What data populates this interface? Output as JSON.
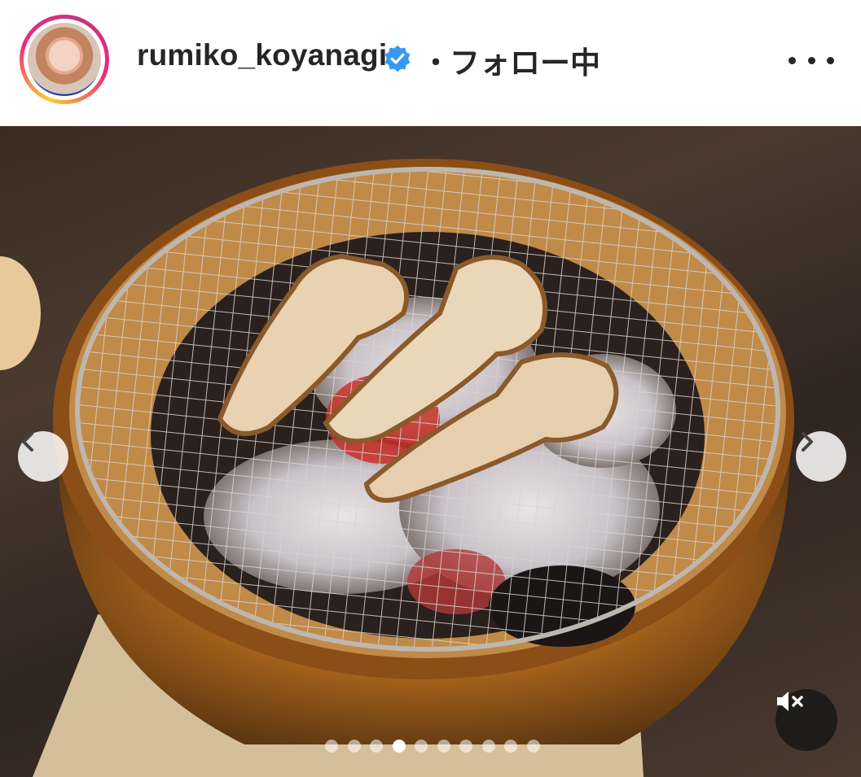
{
  "post": {
    "username": "rumiko_koyanagi",
    "verified": true,
    "separator": "・",
    "follow_status": "フォロー中"
  },
  "icons": {
    "avatar": "profile-avatar",
    "verified": "verified-badge-icon",
    "more": "more-options-icon",
    "prev": "chevron-left-icon",
    "next": "chevron-right-icon",
    "mute": "speaker-muted-icon"
  },
  "carousel": {
    "total_slides": 10,
    "active_slide": 4
  },
  "colors": {
    "verified_blue": "#3897f0",
    "text": "#262626",
    "story_ring_start": "#f9ce34",
    "story_ring_end": "#ee2a7b"
  }
}
